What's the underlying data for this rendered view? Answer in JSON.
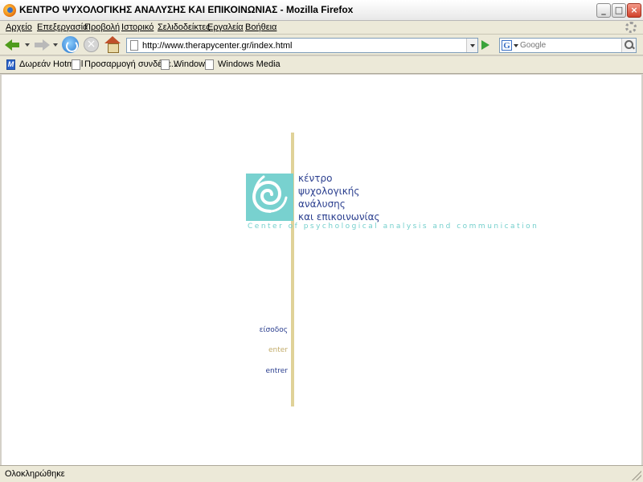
{
  "window": {
    "title": "ΚΕΝΤΡΟ ΨΥΧΟΛΟΓΙΚΗΣ ΑΝΑΛΥΣΗΣ ΚΑΙ ΕΠΙΚΟΙΝΩΝΙΑΣ - Mozilla Firefox",
    "minimize_glyph": "_",
    "maximize_glyph": "□",
    "close_glyph": "×"
  },
  "menu": {
    "items": [
      "Αρχείο",
      "Επεξεργασία",
      "Προβολή",
      "Ιστορικό",
      "Σελιδοδείκτες",
      "Εργαλεία",
      "Βοήθεια"
    ]
  },
  "navigation": {
    "url": "http://www.therapycenter.gr/index.html",
    "search_engine_glyph": "G",
    "search_placeholder": "Google"
  },
  "bookmarks": {
    "items": [
      {
        "label": "Δωρεάν Hotmail",
        "icon": "msn-icon",
        "glyph": "M"
      },
      {
        "label": "Προσαρμογή συνδέσε...",
        "icon": "page-icon"
      },
      {
        "label": "Windows",
        "icon": "page-icon"
      },
      {
        "label": "Windows Media",
        "icon": "page-icon"
      }
    ]
  },
  "page": {
    "logo_lines": [
      "κέντρο",
      "ψυχολογικής",
      "ανάλυσης",
      "και επικοινωνίας"
    ],
    "tagline": "Center of psychological analysis and communication",
    "enter_greek": "είσοδος",
    "enter_en_1": "enter",
    "enter_en_2": "entrer",
    "colors": {
      "navy": "#2b3f8f",
      "teal": "#78d1cf",
      "gold": "#e0d298",
      "tan": "#c2ac6a"
    }
  },
  "status": {
    "text": "Ολοκληρώθηκε"
  }
}
